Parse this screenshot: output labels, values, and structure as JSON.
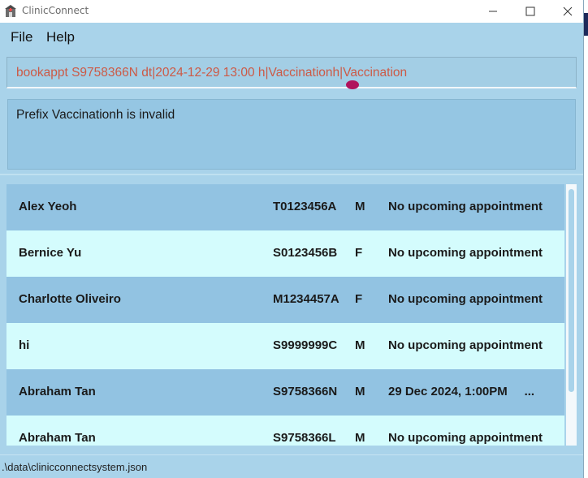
{
  "window": {
    "title": "ClinicConnect",
    "controls": {
      "minimize": "minimize-icon",
      "maximize": "maximize-icon",
      "close": "close-icon"
    }
  },
  "menu": {
    "file": "File",
    "help": "Help"
  },
  "command": {
    "value": "bookappt S9758366N dt|2024-12-29 13:00 h|Vaccinationh|Vaccination",
    "text_color": "#cc5a46"
  },
  "result": {
    "message": "Prefix Vaccinationh is invalid"
  },
  "patients": [
    {
      "name": "Alex Yeoh",
      "nric": "T0123456A",
      "sex": "M",
      "appointment": "No upcoming appointment"
    },
    {
      "name": "Bernice Yu",
      "nric": "S0123456B",
      "sex": "F",
      "appointment": "No upcoming appointment"
    },
    {
      "name": "Charlotte Oliveiro",
      "nric": "M1234457A",
      "sex": "F",
      "appointment": "No upcoming appointment"
    },
    {
      "name": "hi",
      "nric": "S9999999C",
      "sex": "M",
      "appointment": "No upcoming appointment"
    },
    {
      "name": "Abraham Tan",
      "nric": "S9758366N",
      "sex": "M",
      "appointment": "29 Dec 2024, 1:00PM     ..."
    },
    {
      "name": "Abraham Tan",
      "nric": "S9758366L",
      "sex": "M",
      "appointment": "No upcoming appointment"
    }
  ],
  "status": {
    "file_path": ".\\data\\clinicconnectsystem.json"
  },
  "colors": {
    "background": "#a9d3ea",
    "row_dark": "#92c3e2",
    "row_light": "#d4fcfd",
    "error_text": "#cc5a46"
  }
}
